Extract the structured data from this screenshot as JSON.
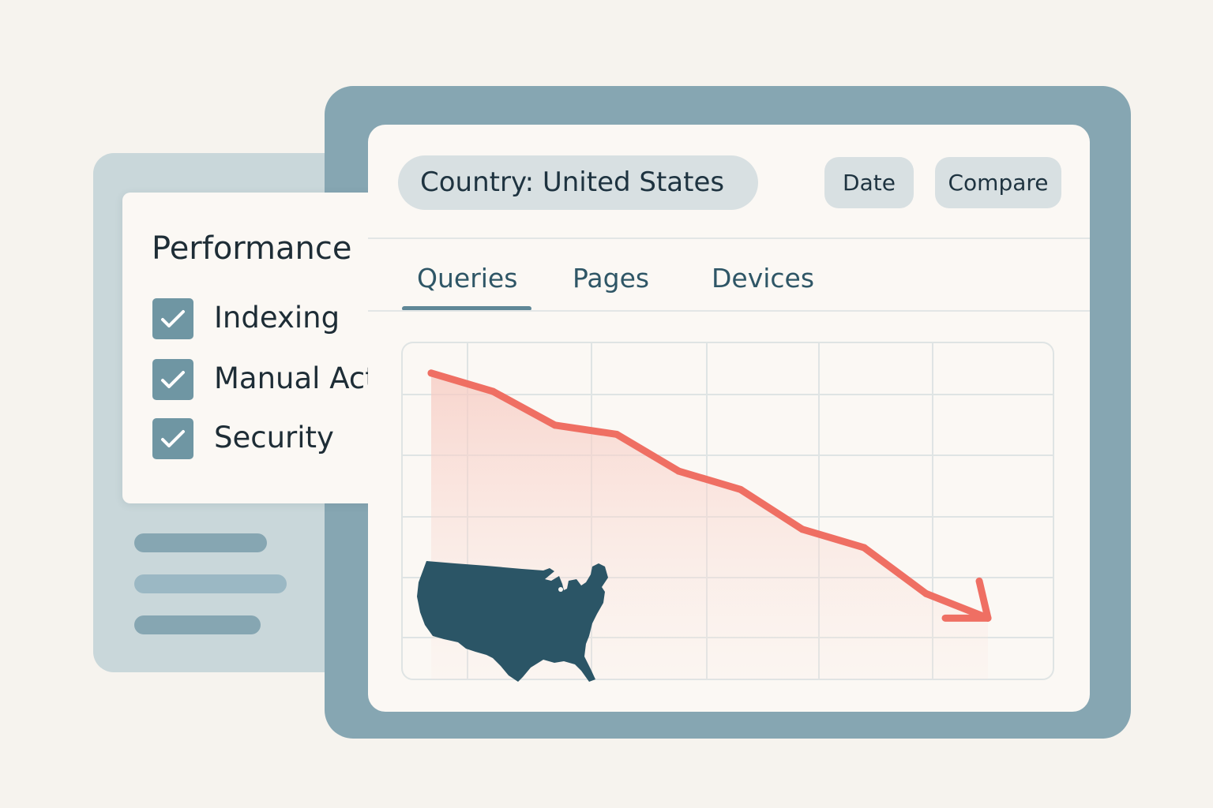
{
  "sidebar": {
    "title": "Performance",
    "items": [
      {
        "label": "Indexing",
        "checked": true
      },
      {
        "label": "Manual Actions",
        "checked": true
      },
      {
        "label": "Security",
        "checked": true
      }
    ]
  },
  "toolbar": {
    "filter_label": "Country: United States",
    "date_label": "Date",
    "compare_label": "Compare"
  },
  "tabs": [
    {
      "label": "Queries",
      "active": true
    },
    {
      "label": "Pages",
      "active": false
    },
    {
      "label": "Devices",
      "active": false
    }
  ],
  "colors": {
    "accent": "#ef6f63",
    "frame": "#86a6b2",
    "map": "#2b5566"
  },
  "chart_data": {
    "type": "line",
    "trend": "declining",
    "series": [
      {
        "values": [
          10.0,
          9.4,
          8.3,
          8.0,
          6.8,
          6.2,
          4.9,
          4.3,
          2.8,
          2.0
        ]
      }
    ],
    "ylim": [
      0,
      11
    ],
    "grid": true,
    "end_marker": "arrow",
    "overlay_icon": "united-states-map-icon"
  }
}
